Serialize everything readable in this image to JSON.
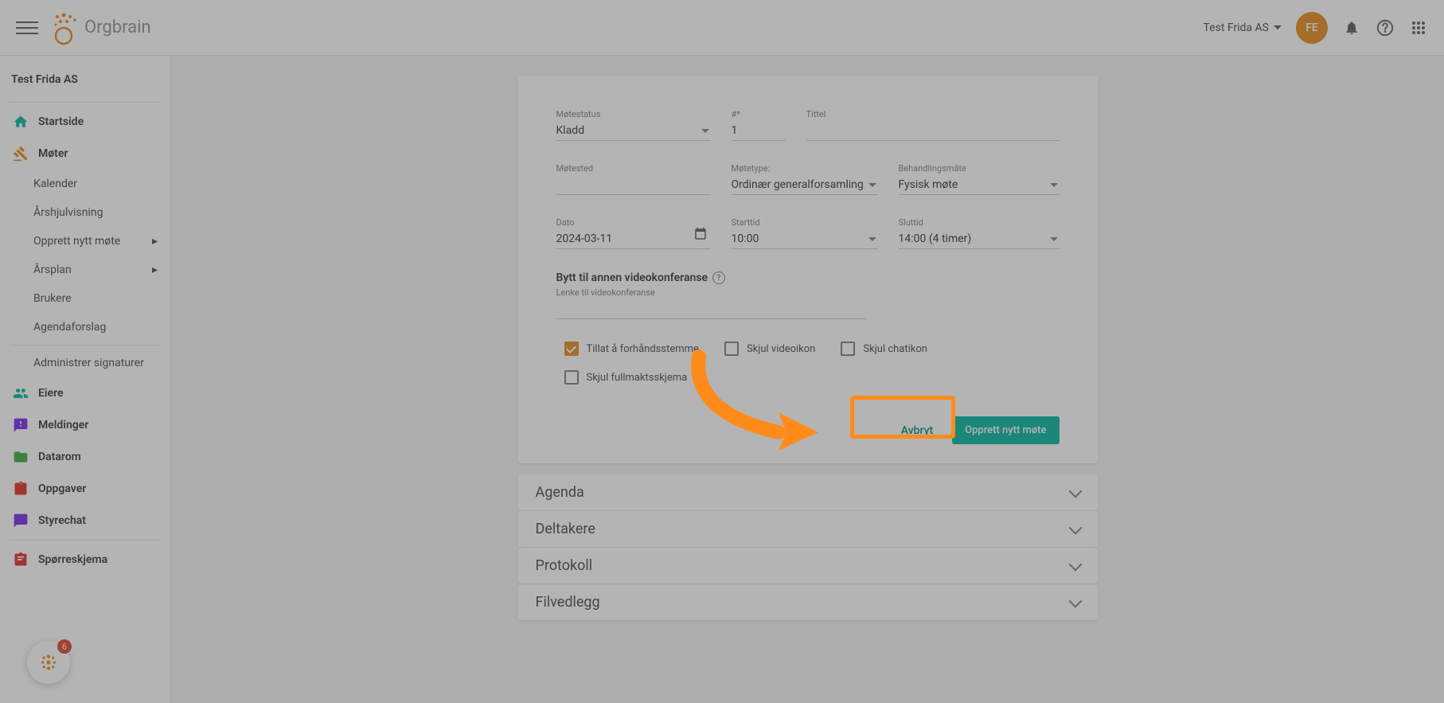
{
  "header": {
    "org_name": "Test Frida AS",
    "avatar_initials": "FE"
  },
  "sidebar": {
    "title": "Test Frida AS",
    "items": {
      "home": "Startside",
      "meetings": "Møter",
      "calendar": "Kalender",
      "yearview": "Årshjulvisning",
      "create": "Opprett nytt møte",
      "yearplan": "Årsplan",
      "users": "Brukere",
      "agenda_suggest": "Agendaforslag",
      "signatures": "Administrer signaturer",
      "owners": "Eiere",
      "messages": "Meldinger",
      "dataroom": "Datarom",
      "tasks": "Oppgaver",
      "boardchat": "Styrechat",
      "questionnaire": "Spørreskjema"
    }
  },
  "form": {
    "status_label": "Møtestatus",
    "status_value": "Kladd",
    "num_label": "#*",
    "num_value": "1",
    "title_label": "Tittel",
    "title_value": "",
    "place_label": "Møtested",
    "place_value": "",
    "type_label": "Møtetype:",
    "type_value": "Ordinær generalforsamling",
    "method_label": "Behandlingsmåte",
    "method_value": "Fysisk møte",
    "date_label": "Dato",
    "date_value": "2024-03-11",
    "start_label": "Starttid",
    "start_value": "10:00",
    "end_label": "Sluttid",
    "end_value": "14:00 (4 timer)",
    "video_switch": "Bytt til annen videokonferanse",
    "video_link_label": "Lenke til videokonferanse",
    "cb_prevote": "Tillat å forhåndsstemme",
    "cb_hidevideo": "Skjul videoikon",
    "cb_hidechat": "Skjul chatikon",
    "cb_hideproxy": "Skjul fullmaktsskjema",
    "cancel": "Avbryt",
    "submit": "Opprett nytt møte"
  },
  "accordions": {
    "agenda": "Agenda",
    "participants": "Deltakere",
    "protocol": "Protokoll",
    "attachments": "Filvedlegg"
  },
  "chat_badge": "6"
}
